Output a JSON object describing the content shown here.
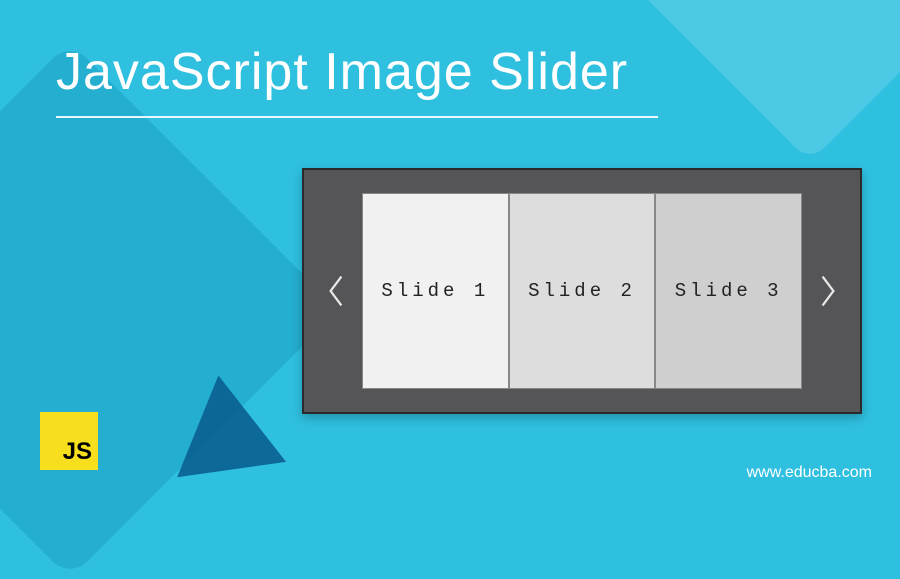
{
  "title": "JavaScript Image Slider",
  "slider": {
    "slides": [
      {
        "label": "Slide 1"
      },
      {
        "label": "Slide 2"
      },
      {
        "label": "Slide 3"
      }
    ]
  },
  "logo": {
    "text": "JS"
  },
  "attribution": "www.educba.com"
}
